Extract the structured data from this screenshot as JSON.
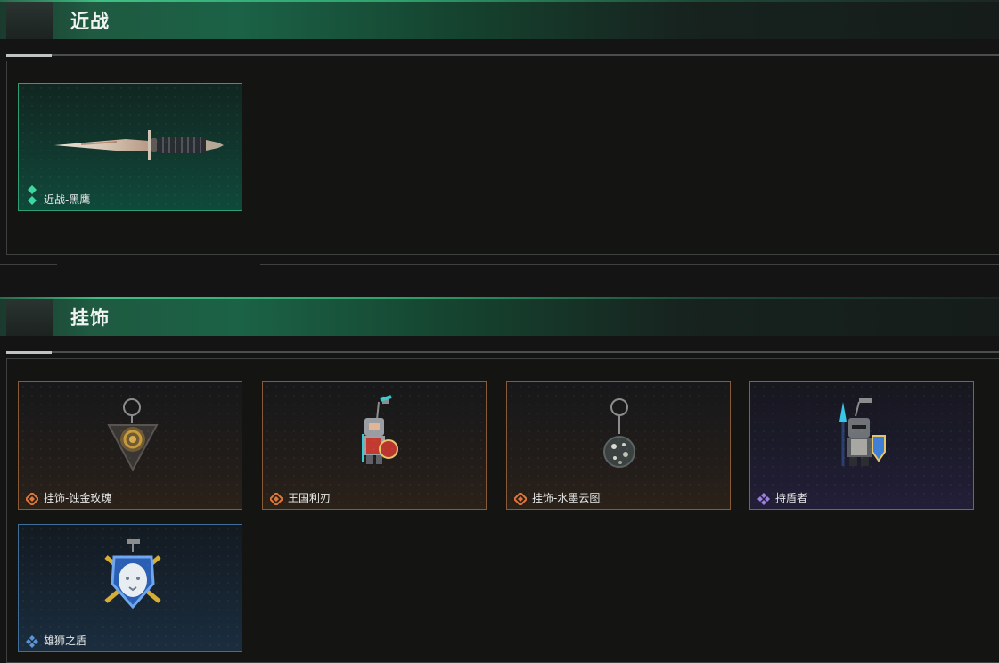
{
  "sections": [
    {
      "title": "近战",
      "items": [
        {
          "label": "近战-黑鹰",
          "rarity": "green",
          "icon": "combat-knife-icon"
        }
      ]
    },
    {
      "title": "挂饰",
      "items": [
        {
          "label": "挂饰-蚀金玫瑰",
          "rarity": "orange",
          "icon": "rose-charm-icon"
        },
        {
          "label": "王国利刃",
          "rarity": "orange",
          "icon": "knight-charm-icon"
        },
        {
          "label": "挂饰-水墨云图",
          "rarity": "orange",
          "icon": "sphere-charm-icon"
        },
        {
          "label": "持盾者",
          "rarity": "purple",
          "icon": "shield-bearer-charm-icon"
        },
        {
          "label": "雄狮之盾",
          "rarity": "blue",
          "icon": "lion-shield-charm-icon"
        }
      ]
    }
  ],
  "colors": {
    "green": "#2f9e74",
    "orange": "#e0773a",
    "purple": "#9a7fe0",
    "blue": "#5a93d6"
  }
}
